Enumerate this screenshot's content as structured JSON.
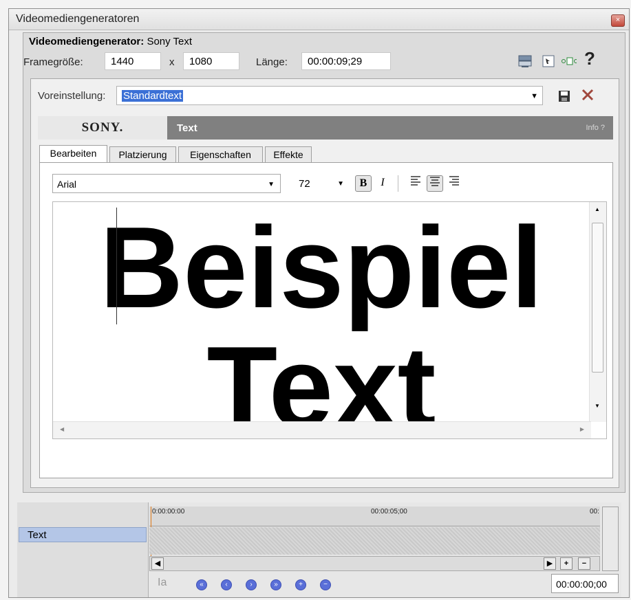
{
  "window": {
    "title": "Videomediengeneratoren",
    "close_glyph": "×"
  },
  "generator": {
    "label": "Videomediengenerator:",
    "value": "Sony Text"
  },
  "frame": {
    "label": "Framegröße:",
    "width": "1440",
    "x": "x",
    "height": "1080",
    "length_label": "Länge:",
    "length": "00:00:09;29"
  },
  "toolbar_icons": [
    "output-icon",
    "properties-icon",
    "split-icon",
    "help-icon"
  ],
  "help_glyph": "?",
  "preset": {
    "label": "Voreinstellung:",
    "value": "Standardtext"
  },
  "plugin": {
    "brand": "SONY.",
    "title": "Text",
    "info": "Info  ?"
  },
  "tabs": [
    "Bearbeiten",
    "Platzierung",
    "Eigenschaften",
    "Effekte"
  ],
  "font": {
    "family": "Arial",
    "size": "72",
    "bold": "B",
    "italic": "I"
  },
  "editor": {
    "line1": "Beispiel",
    "line2": "Text"
  },
  "timeline": {
    "track": "Text",
    "ruler": [
      "0:00:00:00",
      "00:00:05;00",
      "00:"
    ],
    "timecode": "00:00:00;00"
  }
}
